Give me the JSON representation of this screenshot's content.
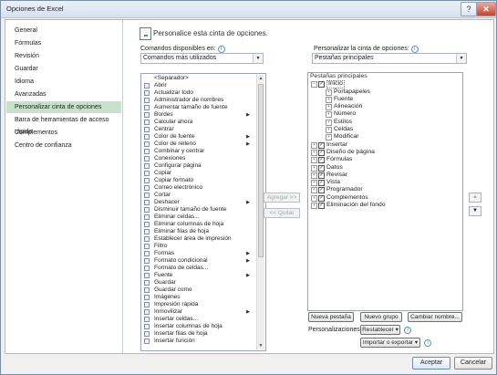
{
  "window": {
    "title": "Opciones de Excel",
    "help_glyph": "?",
    "close_glyph": "✕"
  },
  "nav": {
    "items": [
      {
        "label": "General"
      },
      {
        "label": "Fórmulas"
      },
      {
        "label": "Revisión"
      },
      {
        "label": "Guardar"
      },
      {
        "label": "Idioma"
      },
      {
        "label": "Avanzadas"
      },
      {
        "label": "Personalizar cinta de opciones",
        "selected": true
      },
      {
        "label": "Barra de herramientas de acceso rápido"
      },
      {
        "label": "Complementos"
      },
      {
        "label": "Centro de confianza"
      }
    ]
  },
  "header": {
    "title": "Personalice esta cinta de opciones."
  },
  "left": {
    "label": "Comandos disponibles en:",
    "combo_value": "Comandos más utilizados",
    "commands": [
      {
        "label": "<Separador>",
        "sub": false
      },
      {
        "label": "Abrir",
        "sub": false
      },
      {
        "label": "Actualizar todo",
        "sub": false
      },
      {
        "label": "Administrador de nombres",
        "sub": false
      },
      {
        "label": "Aumentar tamaño de fuente",
        "sub": false
      },
      {
        "label": "Bordes",
        "sub": true
      },
      {
        "label": "Calcular ahora",
        "sub": false
      },
      {
        "label": "Centrar",
        "sub": false
      },
      {
        "label": "Color de fuente",
        "sub": true
      },
      {
        "label": "Color de relleno",
        "sub": true
      },
      {
        "label": "Combinar y centrar",
        "sub": false
      },
      {
        "label": "Conexiones",
        "sub": false
      },
      {
        "label": "Configurar página",
        "sub": false
      },
      {
        "label": "Copiar",
        "sub": false
      },
      {
        "label": "Copiar formato",
        "sub": false
      },
      {
        "label": "Correo electrónico",
        "sub": false
      },
      {
        "label": "Cortar",
        "sub": false
      },
      {
        "label": "Deshacer",
        "sub": true
      },
      {
        "label": "Disminuir tamaño de fuente",
        "sub": false
      },
      {
        "label": "Eliminar celdas...",
        "sub": false
      },
      {
        "label": "Eliminar columnas de hoja",
        "sub": false
      },
      {
        "label": "Eliminar filas de hoja",
        "sub": false
      },
      {
        "label": "Establecer área de impresión",
        "sub": false
      },
      {
        "label": "Filtro",
        "sub": false
      },
      {
        "label": "Formas",
        "sub": true
      },
      {
        "label": "Formato condicional",
        "sub": true
      },
      {
        "label": "Formato de celdas...",
        "sub": false
      },
      {
        "label": "Fuente",
        "sub": true
      },
      {
        "label": "Guardar",
        "sub": false
      },
      {
        "label": "Guardar como",
        "sub": false
      },
      {
        "label": "Imágenes",
        "sub": false
      },
      {
        "label": "Impresión rápida",
        "sub": false
      },
      {
        "label": "Inmovilizar",
        "sub": true
      },
      {
        "label": "Insertar celdas...",
        "sub": false
      },
      {
        "label": "Insertar columnas de hoja",
        "sub": false
      },
      {
        "label": "Insertar filas de hoja",
        "sub": false
      },
      {
        "label": "Insertar función",
        "sub": false
      }
    ]
  },
  "middle": {
    "add_label": "Agregar >>",
    "remove_label": "<< Quitar"
  },
  "right": {
    "label": "Personalizar la cinta de opciones:",
    "combo_value": "Pestañas principales",
    "tree_header": "Pestañas principales",
    "tree": [
      {
        "label": "Inicio",
        "level": 0,
        "exp": "−",
        "checked": true,
        "selected": true
      },
      {
        "label": "Portapapeles",
        "level": 1,
        "exp": "+",
        "checked": null
      },
      {
        "label": "Fuente",
        "level": 1,
        "exp": "+",
        "checked": null
      },
      {
        "label": "Alineación",
        "level": 1,
        "exp": "+",
        "checked": null
      },
      {
        "label": "Número",
        "level": 1,
        "exp": "+",
        "checked": null
      },
      {
        "label": "Estilos",
        "level": 1,
        "exp": "+",
        "checked": null
      },
      {
        "label": "Celdas",
        "level": 1,
        "exp": "+",
        "checked": null
      },
      {
        "label": "Modificar",
        "level": 1,
        "exp": "+",
        "checked": null
      },
      {
        "label": "Insertar",
        "level": 0,
        "exp": "+",
        "checked": true
      },
      {
        "label": "Diseño de página",
        "level": 0,
        "exp": "+",
        "checked": true
      },
      {
        "label": "Fórmulas",
        "level": 0,
        "exp": "+",
        "checked": true
      },
      {
        "label": "Datos",
        "level": 0,
        "exp": "+",
        "checked": true
      },
      {
        "label": "Revisar",
        "level": 0,
        "exp": "+",
        "checked": true
      },
      {
        "label": "Vista",
        "level": 0,
        "exp": "+",
        "checked": true
      },
      {
        "label": "Programador",
        "level": 0,
        "exp": "+",
        "checked": true
      },
      {
        "label": "Complementos",
        "level": 0,
        "exp": "+",
        "checked": true
      },
      {
        "label": "Eliminación del fondo",
        "level": 0,
        "exp": "+",
        "checked": true
      }
    ],
    "move_up_glyph": "▲",
    "move_down_glyph": "▼",
    "new_tab_label": "Nueva pestaña",
    "new_group_label": "Nuevo grupo",
    "rename_label": "Cambiar nombre...",
    "customizations_label": "Personalizaciones:",
    "reset_label": "Restablecer ▾",
    "import_export_label": "Importar o exportar ▾"
  },
  "footer": {
    "ok_label": "Aceptar",
    "cancel_label": "Cancelar"
  }
}
